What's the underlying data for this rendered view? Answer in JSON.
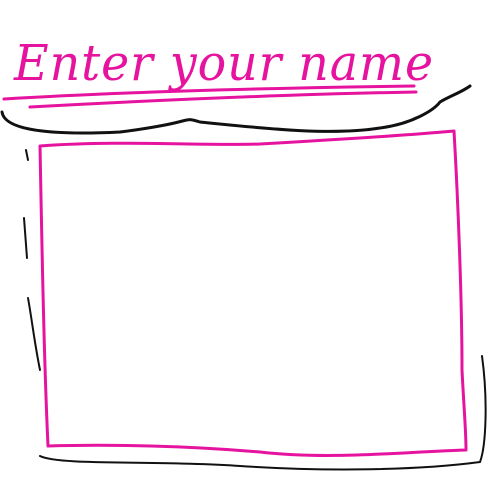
{
  "prompt": {
    "title": "Enter your name"
  },
  "name_field": {
    "value": ""
  },
  "colors": {
    "ink": "#e6139f",
    "shadow": "#111111",
    "background": "#ffffff"
  }
}
